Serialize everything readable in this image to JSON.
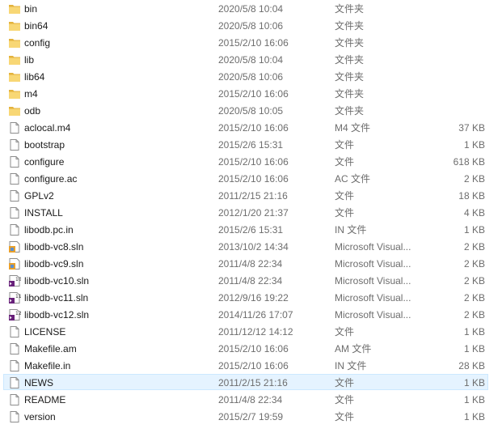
{
  "files": [
    {
      "name": "bin",
      "date": "2020/5/8 10:04",
      "type": "文件夹",
      "size": "",
      "icon": "folder-icon"
    },
    {
      "name": "bin64",
      "date": "2020/5/8 10:06",
      "type": "文件夹",
      "size": "",
      "icon": "folder-icon"
    },
    {
      "name": "config",
      "date": "2015/2/10 16:06",
      "type": "文件夹",
      "size": "",
      "icon": "folder-icon"
    },
    {
      "name": "lib",
      "date": "2020/5/8 10:04",
      "type": "文件夹",
      "size": "",
      "icon": "folder-icon"
    },
    {
      "name": "lib64",
      "date": "2020/5/8 10:06",
      "type": "文件夹",
      "size": "",
      "icon": "folder-icon"
    },
    {
      "name": "m4",
      "date": "2015/2/10 16:06",
      "type": "文件夹",
      "size": "",
      "icon": "folder-icon"
    },
    {
      "name": "odb",
      "date": "2020/5/8 10:05",
      "type": "文件夹",
      "size": "",
      "icon": "folder-icon"
    },
    {
      "name": "aclocal.m4",
      "date": "2015/2/10 16:06",
      "type": "M4 文件",
      "size": "37 KB",
      "icon": "file-icon"
    },
    {
      "name": "bootstrap",
      "date": "2015/2/6 15:31",
      "type": "文件",
      "size": "1 KB",
      "icon": "file-icon"
    },
    {
      "name": "configure",
      "date": "2015/2/10 16:06",
      "type": "文件",
      "size": "618 KB",
      "icon": "file-icon"
    },
    {
      "name": "configure.ac",
      "date": "2015/2/10 16:06",
      "type": "AC 文件",
      "size": "2 KB",
      "icon": "file-icon"
    },
    {
      "name": "GPLv2",
      "date": "2011/2/15 21:16",
      "type": "文件",
      "size": "18 KB",
      "icon": "file-icon"
    },
    {
      "name": "INSTALL",
      "date": "2012/1/20 21:37",
      "type": "文件",
      "size": "4 KB",
      "icon": "file-icon"
    },
    {
      "name": "libodb.pc.in",
      "date": "2015/2/6 15:31",
      "type": "IN 文件",
      "size": "1 KB",
      "icon": "file-icon"
    },
    {
      "name": "libodb-vc8.sln",
      "date": "2013/10/2 14:34",
      "type": "Microsoft Visual...",
      "size": "2 KB",
      "icon": "vs-solution-icon",
      "badge": ""
    },
    {
      "name": "libodb-vc9.sln",
      "date": "2011/4/8 22:34",
      "type": "Microsoft Visual...",
      "size": "2 KB",
      "icon": "vs-solution-icon",
      "badge": ""
    },
    {
      "name": "libodb-vc10.sln",
      "date": "2011/4/8 22:34",
      "type": "Microsoft Visual...",
      "size": "2 KB",
      "icon": "vs-solution-icon",
      "badge": "10"
    },
    {
      "name": "libodb-vc11.sln",
      "date": "2012/9/16 19:22",
      "type": "Microsoft Visual...",
      "size": "2 KB",
      "icon": "vs-solution-icon",
      "badge": "11"
    },
    {
      "name": "libodb-vc12.sln",
      "date": "2014/11/26 17:07",
      "type": "Microsoft Visual...",
      "size": "2 KB",
      "icon": "vs-solution-icon",
      "badge": "12"
    },
    {
      "name": "LICENSE",
      "date": "2011/12/12 14:12",
      "type": "文件",
      "size": "1 KB",
      "icon": "file-icon"
    },
    {
      "name": "Makefile.am",
      "date": "2015/2/10 16:06",
      "type": "AM 文件",
      "size": "1 KB",
      "icon": "file-icon"
    },
    {
      "name": "Makefile.in",
      "date": "2015/2/10 16:06",
      "type": "IN 文件",
      "size": "28 KB",
      "icon": "file-icon"
    },
    {
      "name": "NEWS",
      "date": "2011/2/15 21:16",
      "type": "文件",
      "size": "1 KB",
      "icon": "file-icon",
      "hover": true
    },
    {
      "name": "README",
      "date": "2011/4/8 22:34",
      "type": "文件",
      "size": "1 KB",
      "icon": "file-icon"
    },
    {
      "name": "version",
      "date": "2015/2/7 19:59",
      "type": "文件",
      "size": "1 KB",
      "icon": "file-icon"
    }
  ],
  "colors": {
    "folder": "#f8d775",
    "folder_dark": "#e3b23c",
    "hover_bg": "#e5f3ff",
    "hover_border": "#cce8ff",
    "vs_purple": "#68217a"
  }
}
